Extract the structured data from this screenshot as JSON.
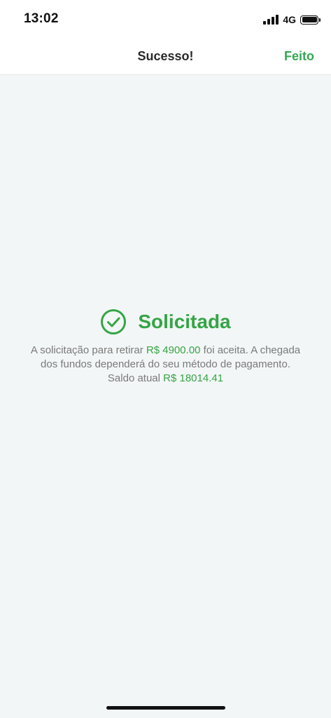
{
  "status_bar": {
    "time": "13:02",
    "network": "4G"
  },
  "nav": {
    "title": "Sucesso!",
    "done_label": "Feito"
  },
  "result": {
    "headline": "Solicitada",
    "message_part1": "A solicitação para retirar ",
    "amount": "R$ 4900.00",
    "message_part2": " foi aceita. A chegada dos fundos dependerá do seu método de pagamento.",
    "balance_label": "Saldo atual ",
    "balance_value": "R$ 18014.41"
  },
  "icons": {
    "success": "check-circle-icon",
    "signal": "signal-icon",
    "battery": "battery-icon"
  },
  "colors": {
    "accent": "#35a546",
    "text_secondary": "#7a7a7a",
    "background": "#f3f6f6"
  }
}
